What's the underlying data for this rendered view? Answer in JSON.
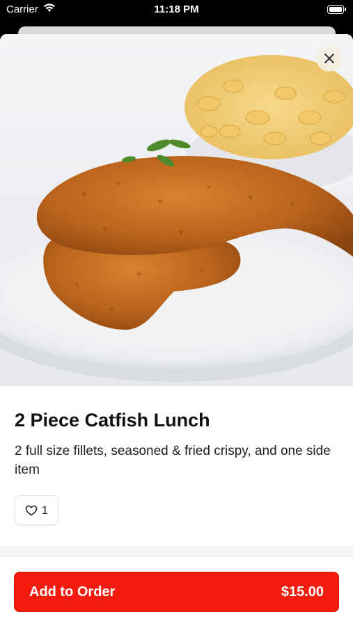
{
  "status_bar": {
    "carrier": "Carrier",
    "time": "11:18 PM"
  },
  "item": {
    "title": "2 Piece Catfish Lunch",
    "description": "2 full size fillets, seasoned & fried crispy, and one side item",
    "likes": "1",
    "image_description": "Photo of fried catfish fillets on a white plate with macaroni and cheese"
  },
  "footer": {
    "add_label": "Add to Order",
    "price": "$15.00"
  },
  "colors": {
    "accent": "#f31c0e"
  },
  "icons": {
    "close": "close-icon",
    "like": "heart-icon"
  }
}
